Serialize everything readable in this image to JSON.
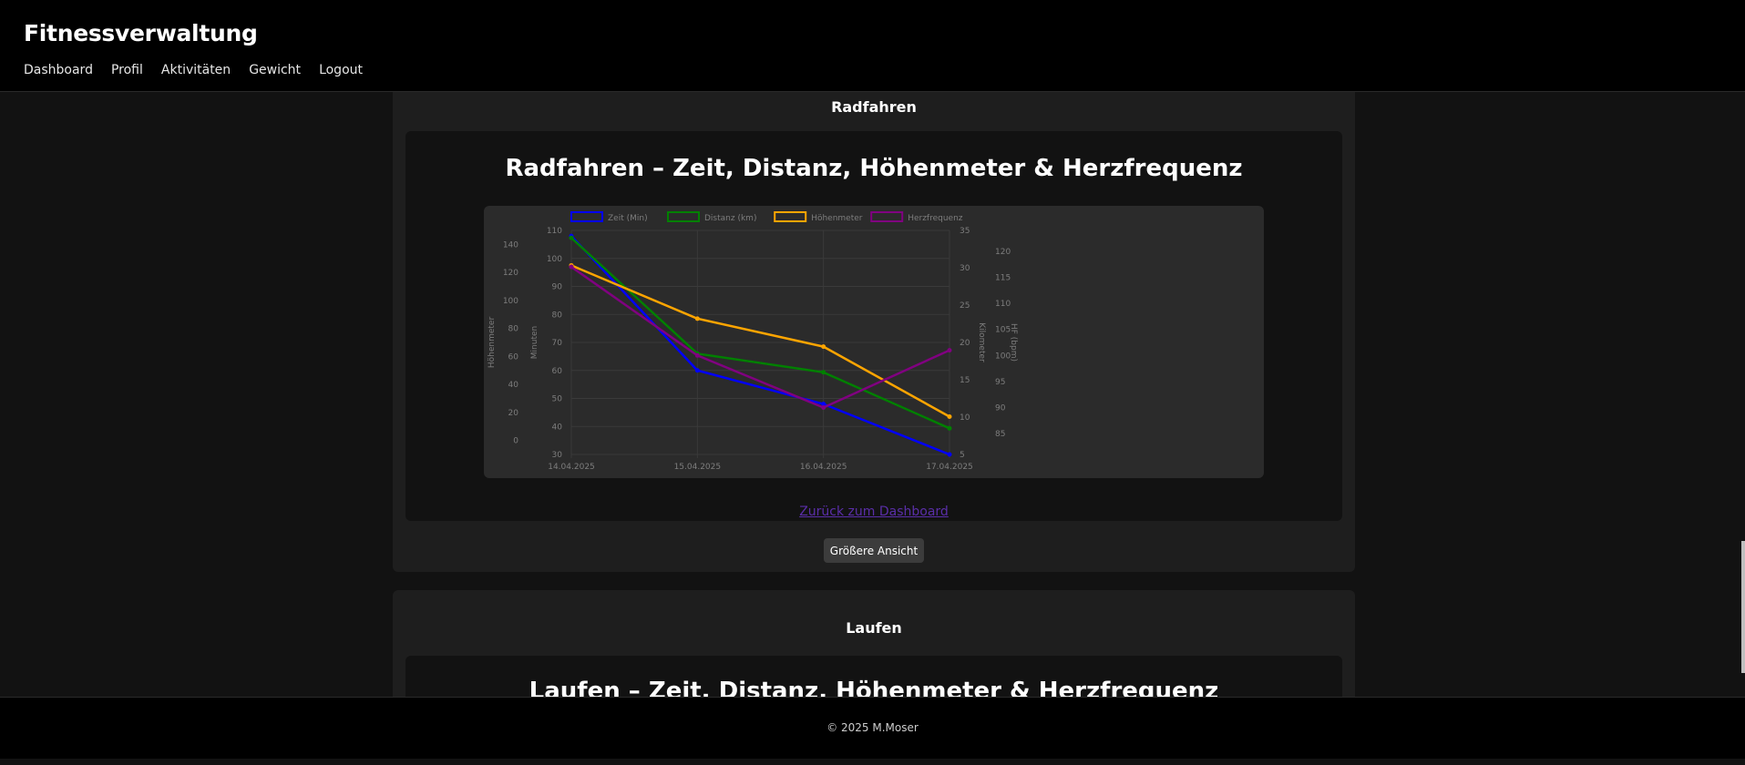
{
  "app": {
    "title": "Fitnessverwaltung",
    "nav": [
      "Dashboard",
      "Profil",
      "Aktivitäten",
      "Gewicht",
      "Logout"
    ]
  },
  "section_cycling": {
    "label": "Radfahren",
    "chart_heading": "Radfahren – Zeit, Distanz, Höhenmeter & Herzfrequenz",
    "back_link": "Zurück zum Dashboard",
    "bigger_view_button": "Größere Ansicht"
  },
  "section_running": {
    "label": "Laufen",
    "chart_heading": "Laufen – Zeit, Distanz, Höhenmeter & Herzfrequenz"
  },
  "footer": {
    "text": "© 2025 M.Moser"
  },
  "chart_data": {
    "type": "line",
    "title": "",
    "categories": [
      "14.04.2025",
      "15.04.2025",
      "16.04.2025",
      "17.04.2025"
    ],
    "legend_position": "top",
    "grid": true,
    "axes": {
      "hm": {
        "label": "Höhenmeter",
        "range": [
          -10,
          150
        ],
        "ticks": [
          0,
          20,
          40,
          60,
          80,
          100,
          120,
          140
        ],
        "side": "left"
      },
      "min": {
        "label": "Minuten",
        "range": [
          30,
          110
        ],
        "ticks": [
          30,
          40,
          50,
          60,
          70,
          80,
          90,
          100,
          110
        ],
        "side": "left"
      },
      "km": {
        "label": "Kilometer",
        "range": [
          5,
          35
        ],
        "ticks": [
          5,
          10,
          15,
          20,
          25,
          30,
          35
        ],
        "side": "right"
      },
      "hf": {
        "label": "HF (bpm)",
        "range": [
          81,
          124
        ],
        "ticks": [
          85,
          90,
          95,
          100,
          105,
          110,
          115,
          120
        ],
        "side": "right"
      }
    },
    "series": [
      {
        "name": "Zeit (Min)",
        "axis": "min",
        "color": "#0000ff",
        "values": [
          108,
          60,
          48,
          30
        ]
      },
      {
        "name": "Distanz (km)",
        "axis": "km",
        "color": "#008000",
        "values": [
          34,
          18.5,
          16,
          8.5
        ]
      },
      {
        "name": "Höhenmeter",
        "axis": "hm",
        "color": "#ffa500",
        "values": [
          125,
          87,
          67,
          17
        ]
      },
      {
        "name": "Herzfrequenz",
        "axis": "hf",
        "color": "#800080",
        "values": [
          117,
          100,
          90,
          101
        ]
      }
    ]
  }
}
